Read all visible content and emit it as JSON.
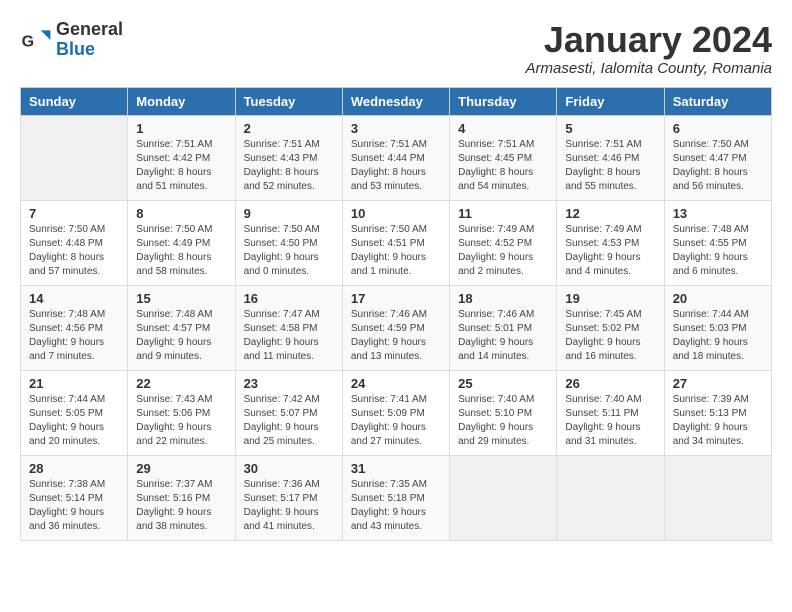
{
  "logo": {
    "text_general": "General",
    "text_blue": "Blue"
  },
  "title": "January 2024",
  "subtitle": "Armasesti, Ialomita County, Romania",
  "header_color": "#2c6fad",
  "days_of_week": [
    "Sunday",
    "Monday",
    "Tuesday",
    "Wednesday",
    "Thursday",
    "Friday",
    "Saturday"
  ],
  "weeks": [
    [
      {
        "day": "",
        "info": ""
      },
      {
        "day": "1",
        "info": "Sunrise: 7:51 AM\nSunset: 4:42 PM\nDaylight: 8 hours\nand 51 minutes."
      },
      {
        "day": "2",
        "info": "Sunrise: 7:51 AM\nSunset: 4:43 PM\nDaylight: 8 hours\nand 52 minutes."
      },
      {
        "day": "3",
        "info": "Sunrise: 7:51 AM\nSunset: 4:44 PM\nDaylight: 8 hours\nand 53 minutes."
      },
      {
        "day": "4",
        "info": "Sunrise: 7:51 AM\nSunset: 4:45 PM\nDaylight: 8 hours\nand 54 minutes."
      },
      {
        "day": "5",
        "info": "Sunrise: 7:51 AM\nSunset: 4:46 PM\nDaylight: 8 hours\nand 55 minutes."
      },
      {
        "day": "6",
        "info": "Sunrise: 7:50 AM\nSunset: 4:47 PM\nDaylight: 8 hours\nand 56 minutes."
      }
    ],
    [
      {
        "day": "7",
        "info": "Sunrise: 7:50 AM\nSunset: 4:48 PM\nDaylight: 8 hours\nand 57 minutes."
      },
      {
        "day": "8",
        "info": "Sunrise: 7:50 AM\nSunset: 4:49 PM\nDaylight: 8 hours\nand 58 minutes."
      },
      {
        "day": "9",
        "info": "Sunrise: 7:50 AM\nSunset: 4:50 PM\nDaylight: 9 hours\nand 0 minutes."
      },
      {
        "day": "10",
        "info": "Sunrise: 7:50 AM\nSunset: 4:51 PM\nDaylight: 9 hours\nand 1 minute."
      },
      {
        "day": "11",
        "info": "Sunrise: 7:49 AM\nSunset: 4:52 PM\nDaylight: 9 hours\nand 2 minutes."
      },
      {
        "day": "12",
        "info": "Sunrise: 7:49 AM\nSunset: 4:53 PM\nDaylight: 9 hours\nand 4 minutes."
      },
      {
        "day": "13",
        "info": "Sunrise: 7:48 AM\nSunset: 4:55 PM\nDaylight: 9 hours\nand 6 minutes."
      }
    ],
    [
      {
        "day": "14",
        "info": "Sunrise: 7:48 AM\nSunset: 4:56 PM\nDaylight: 9 hours\nand 7 minutes."
      },
      {
        "day": "15",
        "info": "Sunrise: 7:48 AM\nSunset: 4:57 PM\nDaylight: 9 hours\nand 9 minutes."
      },
      {
        "day": "16",
        "info": "Sunrise: 7:47 AM\nSunset: 4:58 PM\nDaylight: 9 hours\nand 11 minutes."
      },
      {
        "day": "17",
        "info": "Sunrise: 7:46 AM\nSunset: 4:59 PM\nDaylight: 9 hours\nand 13 minutes."
      },
      {
        "day": "18",
        "info": "Sunrise: 7:46 AM\nSunset: 5:01 PM\nDaylight: 9 hours\nand 14 minutes."
      },
      {
        "day": "19",
        "info": "Sunrise: 7:45 AM\nSunset: 5:02 PM\nDaylight: 9 hours\nand 16 minutes."
      },
      {
        "day": "20",
        "info": "Sunrise: 7:44 AM\nSunset: 5:03 PM\nDaylight: 9 hours\nand 18 minutes."
      }
    ],
    [
      {
        "day": "21",
        "info": "Sunrise: 7:44 AM\nSunset: 5:05 PM\nDaylight: 9 hours\nand 20 minutes."
      },
      {
        "day": "22",
        "info": "Sunrise: 7:43 AM\nSunset: 5:06 PM\nDaylight: 9 hours\nand 22 minutes."
      },
      {
        "day": "23",
        "info": "Sunrise: 7:42 AM\nSunset: 5:07 PM\nDaylight: 9 hours\nand 25 minutes."
      },
      {
        "day": "24",
        "info": "Sunrise: 7:41 AM\nSunset: 5:09 PM\nDaylight: 9 hours\nand 27 minutes."
      },
      {
        "day": "25",
        "info": "Sunrise: 7:40 AM\nSunset: 5:10 PM\nDaylight: 9 hours\nand 29 minutes."
      },
      {
        "day": "26",
        "info": "Sunrise: 7:40 AM\nSunset: 5:11 PM\nDaylight: 9 hours\nand 31 minutes."
      },
      {
        "day": "27",
        "info": "Sunrise: 7:39 AM\nSunset: 5:13 PM\nDaylight: 9 hours\nand 34 minutes."
      }
    ],
    [
      {
        "day": "28",
        "info": "Sunrise: 7:38 AM\nSunset: 5:14 PM\nDaylight: 9 hours\nand 36 minutes."
      },
      {
        "day": "29",
        "info": "Sunrise: 7:37 AM\nSunset: 5:16 PM\nDaylight: 9 hours\nand 38 minutes."
      },
      {
        "day": "30",
        "info": "Sunrise: 7:36 AM\nSunset: 5:17 PM\nDaylight: 9 hours\nand 41 minutes."
      },
      {
        "day": "31",
        "info": "Sunrise: 7:35 AM\nSunset: 5:18 PM\nDaylight: 9 hours\nand 43 minutes."
      },
      {
        "day": "",
        "info": ""
      },
      {
        "day": "",
        "info": ""
      },
      {
        "day": "",
        "info": ""
      }
    ]
  ]
}
